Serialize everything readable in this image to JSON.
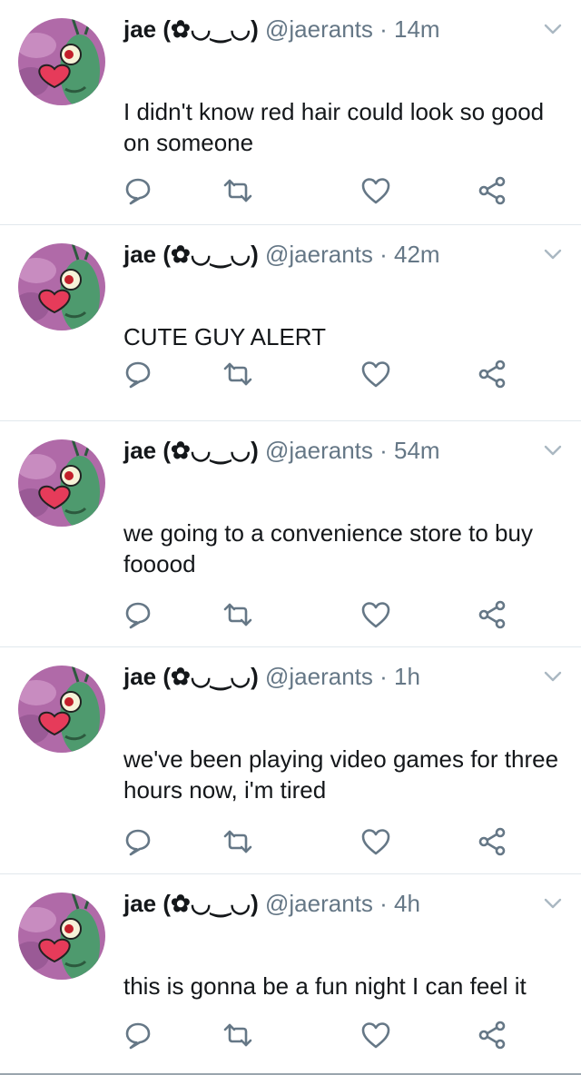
{
  "tweets": [
    {
      "name": "jae (✿◡‿◡)",
      "handle": "@jaerants",
      "dot": " · ",
      "time": "14m",
      "text": "I didn't know red hair could look so good on someone"
    },
    {
      "name": "jae (✿◡‿◡)",
      "handle": "@jaerants",
      "dot": " · ",
      "time": "42m",
      "text": "CUTE GUY ALERT"
    },
    {
      "name": "jae (✿◡‿◡)",
      "handle": "@jaerants",
      "dot": " · ",
      "time": "54m",
      "text": "we going to a convenience store to buy fooood"
    },
    {
      "name": "jae (✿◡‿◡)",
      "handle": "@jaerants",
      "dot": " · ",
      "time": "1h",
      "text": "we've been playing video games for three hours now, i'm tired"
    },
    {
      "name": "jae (✿◡‿◡)",
      "handle": "@jaerants",
      "dot": " · ",
      "time": "4h",
      "text": "this is gonna be a fun night I can feel it"
    }
  ],
  "icons": {
    "avatar": "plankton-heart-avatar",
    "menu": "chevron-down-icon",
    "reply": "reply-icon",
    "retweet": "retweet-icon",
    "like": "heart-icon",
    "share": "share-icon"
  },
  "colors": {
    "icon_gray": "#657786",
    "text": "#14171a",
    "divider": "#e1e8ed",
    "avatar_bg": "#b06aa8",
    "avatar_green": "#4e9a6e"
  }
}
